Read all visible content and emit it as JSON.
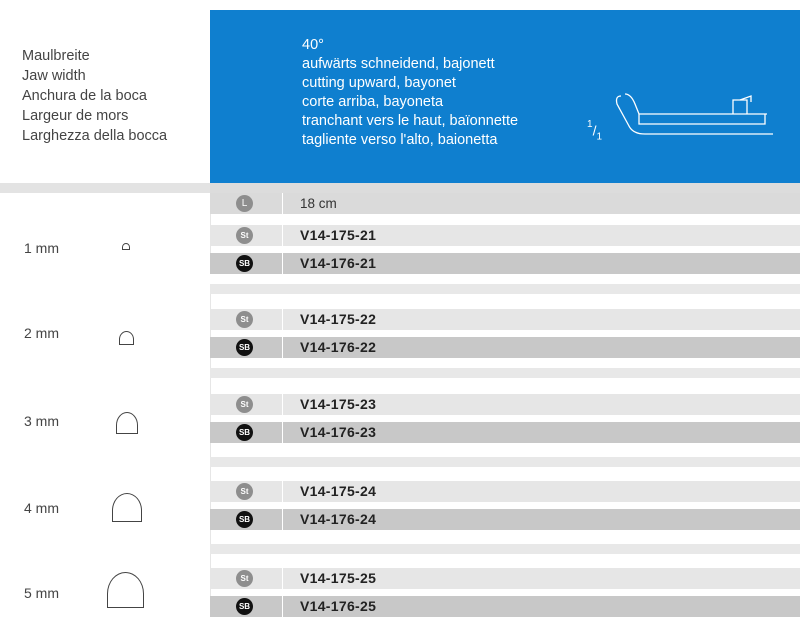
{
  "jaw_width_labels": [
    "Maulbreite",
    "Jaw width",
    "Anchura de la boca",
    "Largeur de mors",
    "Larghezza della bocca"
  ],
  "header": {
    "angle": "40°",
    "descriptions": [
      "aufwärts schneidend, bajonett",
      "cutting upward, bayonet",
      "corte arriba, bayoneta",
      "tranchant vers le haut, baïonnette",
      "tagliente verso l'alto, baionetta"
    ],
    "scale_num": "1",
    "scale_den": "1"
  },
  "length": {
    "badge": "L",
    "value": "18 cm"
  },
  "badges": {
    "st": "St",
    "sb": "SB"
  },
  "sizes": [
    {
      "label": "1 mm",
      "st_code": "V14-175-21",
      "sb_code": "V14-176-21"
    },
    {
      "label": "2 mm",
      "st_code": "V14-175-22",
      "sb_code": "V14-176-22"
    },
    {
      "label": "3 mm",
      "st_code": "V14-175-23",
      "sb_code": "V14-176-23"
    },
    {
      "label": "4 mm",
      "st_code": "V14-175-24",
      "sb_code": "V14-176-24"
    },
    {
      "label": "5 mm",
      "st_code": "V14-175-25",
      "sb_code": "V14-176-25"
    }
  ],
  "colors": {
    "header_blue": "#0f7fcf",
    "st_row": "#e6e6e6",
    "sb_row": "#c8c8c8",
    "sb_badge": "#111111"
  },
  "icons": {
    "instrument": "rongeur-instrument-icon",
    "jaw": "jaw-profile-icon"
  }
}
